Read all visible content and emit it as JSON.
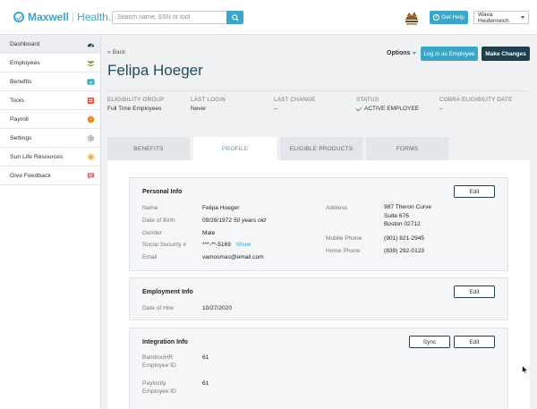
{
  "header": {
    "brand_name": "Maxwell",
    "brand_suffix": "Health.",
    "search_placeholder": "Search name, SSN or tool",
    "help_label": "Get Help",
    "user_name": "Wava Heidenreich"
  },
  "sidebar": {
    "items": [
      {
        "label": "Dashboard",
        "icon": "dashboard-icon",
        "color": "#1f3f4c"
      },
      {
        "label": "Employees",
        "icon": "people-icon",
        "color": "#7aa84a"
      },
      {
        "label": "Benefits",
        "icon": "benefits-card-icon",
        "color": "#3aa7c9"
      },
      {
        "label": "Tools",
        "icon": "tools-icon",
        "color": "#e25a4a"
      },
      {
        "label": "Payroll",
        "icon": "payroll-coin-icon",
        "color": "#e08a2a"
      },
      {
        "label": "Settings",
        "icon": "gear-icon",
        "color": "#7a7f86"
      },
      {
        "label": "Sun Life Resources",
        "icon": "sun-icon",
        "color": "#e8b33a"
      },
      {
        "label": "Give Feedback",
        "icon": "feedback-icon",
        "color": "#e25a6a"
      }
    ]
  },
  "page": {
    "back_label": "Back",
    "employee_name": "Felipa Hoeger",
    "options_label": "Options",
    "login_as_label": "Log in as Employee",
    "make_changes_label": "Make Changes"
  },
  "meta": [
    {
      "label": "ELIGIBILITY GROUP",
      "value": "Full Time Employees"
    },
    {
      "label": "LAST LOGIN",
      "value": "Never"
    },
    {
      "label": "LAST CHANGE",
      "value": "–"
    },
    {
      "label": "STATUS",
      "value": "ACTIVE EMPLOYEE"
    },
    {
      "label": "COBRA ELIGIBILITY DATE",
      "value": "–"
    }
  ],
  "tabs": [
    {
      "label": "BENEFITS"
    },
    {
      "label": "PROFILE"
    },
    {
      "label": "ELIGIBLE PRODUCTS"
    },
    {
      "label": "FORMS"
    }
  ],
  "personal_info": {
    "title": "Personal Info",
    "edit_label": "Edit",
    "name_label": "Name",
    "name": "Felipa Hoeger",
    "dob_label": "Date of Birth",
    "dob": "09/26/1972",
    "age": "50 years old",
    "gender_label": "Gender",
    "gender": "Male",
    "ssn_label": "Social Security #",
    "ssn": "***-**-5169",
    "show_label": "Show",
    "email_label": "Email",
    "email": "vamosmas@email.com",
    "address_label": "Address",
    "address_line1": "987 Theron Curve",
    "address_line2": "Suite 676",
    "address_line3": "Boston 02712",
    "mobile_label": "Mobile Phone",
    "mobile": "(901) 821-2945",
    "home_label": "Home Phone",
    "home": "(839) 292-0123"
  },
  "employment_info": {
    "title": "Employment Info",
    "edit_label": "Edit",
    "hire_label": "Date of Hire",
    "hire_date": "10/27/2020"
  },
  "integration_info": {
    "title": "Integration Info",
    "sync_label": "Sync",
    "edit_label": "Edit",
    "bamboo_label_1": "BambooHR",
    "bamboo_label_2": "Employee ID",
    "bamboo_id": "61",
    "paylocity_label_1": "Paylocity",
    "paylocity_label_2": "Employee ID",
    "paylocity_id": "61"
  },
  "colors": {
    "accent": "#3aa7c9",
    "dark": "#1f3f4c",
    "title": "#1e4d5f",
    "status_ok": "#4aa05a"
  }
}
